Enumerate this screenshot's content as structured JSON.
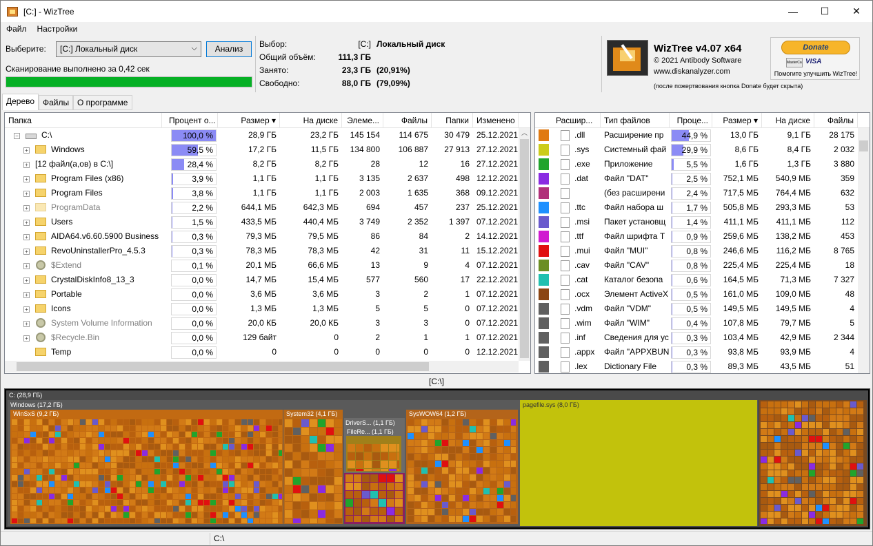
{
  "window": {
    "title": "[C:]  - WizTree",
    "minimize": "—",
    "maximize": "☐",
    "close": "✕"
  },
  "menu": [
    "Файл",
    "Настройки"
  ],
  "scan": {
    "select_label": "Выберите:",
    "drive_value": "[C:] Локальный диск",
    "analyze_button": "Анализ",
    "status_text": "Сканирование выполнено за 0,42 сек",
    "progress": 1.0
  },
  "info": {
    "selection_label": "Выбор:",
    "selection_drive": "[C:]",
    "selection_name": "Локальный диск",
    "total_label": "Общий объём:",
    "total_value": "111,3 ГБ",
    "used_label": "Занято:",
    "used_value": "23,3 ГБ",
    "used_pct": "(20,91%)",
    "free_label": "Свободно:",
    "free_value": "88,0 ГБ",
    "free_pct": "(79,09%)"
  },
  "brand": {
    "name": "WizTree v4.07 x64",
    "copyright": "© 2021 Antibody Software",
    "site": "www.diskanalyzer.com",
    "note": "(после пожертвования кнопка Donate будет скрыта)",
    "donate_label": "Donate",
    "donate_caption": "Помогите улучшить WizTree!",
    "card1": "MasterCard",
    "card2": "VISA"
  },
  "tabs": [
    "Дерево",
    "Файлы",
    "О программе"
  ],
  "tree": {
    "columns": [
      "Папка",
      "Процент о...",
      "Размер",
      "На диске",
      "Элеме...",
      "Файлы",
      "Папки",
      "Изменено"
    ],
    "rows": [
      {
        "name": "C:\\",
        "icon": "drive",
        "expand": "−",
        "indent": 0,
        "pct": 1.0,
        "pct_text": "100,0 %",
        "size": "28,9 ГБ",
        "disk": "23,2 ГБ",
        "items": "145 154",
        "files": "114 675",
        "folders": "30 479",
        "modified": "25.12.2021"
      },
      {
        "name": "Windows",
        "icon": "folder",
        "expand": "+",
        "indent": 1,
        "pct": 0.595,
        "pct_text": "59,5 %",
        "size": "17,2 ГБ",
        "disk": "11,5 ГБ",
        "items": "134 800",
        "files": "106 887",
        "folders": "27 913",
        "modified": "27.12.2021"
      },
      {
        "name": "[12 файл(а,ов) в C:\\]",
        "icon": "none",
        "expand": "+",
        "indent": 1,
        "pct": 0.284,
        "pct_text": "28,4 %",
        "size": "8,2 ГБ",
        "disk": "8,2 ГБ",
        "items": "28",
        "files": "12",
        "folders": "16",
        "modified": "27.12.2021"
      },
      {
        "name": "Program Files (x86)",
        "icon": "folder",
        "expand": "+",
        "indent": 1,
        "pct": 0.039,
        "pct_text": "3,9 %",
        "size": "1,1 ГБ",
        "disk": "1,1 ГБ",
        "items": "3 135",
        "files": "2 637",
        "folders": "498",
        "modified": "12.12.2021"
      },
      {
        "name": "Program Files",
        "icon": "folder",
        "expand": "+",
        "indent": 1,
        "pct": 0.038,
        "pct_text": "3,8 %",
        "size": "1,1 ГБ",
        "disk": "1,1 ГБ",
        "items": "2 003",
        "files": "1 635",
        "folders": "368",
        "modified": "09.12.2021"
      },
      {
        "name": "ProgramData",
        "icon": "folder-hidden",
        "expand": "+",
        "indent": 1,
        "pct": 0.022,
        "pct_text": "2,2 %",
        "size": "644,1 МБ",
        "disk": "642,3 МБ",
        "items": "694",
        "files": "457",
        "folders": "237",
        "modified": "25.12.2021"
      },
      {
        "name": "Users",
        "icon": "folder",
        "expand": "+",
        "indent": 1,
        "pct": 0.015,
        "pct_text": "1,5 %",
        "size": "433,5 МБ",
        "disk": "440,4 МБ",
        "items": "3 749",
        "files": "2 352",
        "folders": "1 397",
        "modified": "07.12.2021"
      },
      {
        "name": "AIDA64.v6.60.5900 Business",
        "icon": "folder",
        "expand": "+",
        "indent": 1,
        "pct": 0.003,
        "pct_text": "0,3 %",
        "size": "79,3 МБ",
        "disk": "79,5 МБ",
        "items": "86",
        "files": "84",
        "folders": "2",
        "modified": "14.12.2021"
      },
      {
        "name": "RevoUninstallerPro_4.5.3",
        "icon": "folder",
        "expand": "+",
        "indent": 1,
        "pct": 0.003,
        "pct_text": "0,3 %",
        "size": "78,3 МБ",
        "disk": "78,3 МБ",
        "items": "42",
        "files": "31",
        "folders": "11",
        "modified": "15.12.2021"
      },
      {
        "name": "$Extend",
        "icon": "gear",
        "expand": "+",
        "indent": 1,
        "pct": 0.001,
        "pct_text": "0,1 %",
        "size": "20,1 МБ",
        "disk": "66,6 МБ",
        "items": "13",
        "files": "9",
        "folders": "4",
        "modified": "07.12.2021"
      },
      {
        "name": "CrystalDiskInfo8_13_3",
        "icon": "folder",
        "expand": "+",
        "indent": 1,
        "pct": 0.0,
        "pct_text": "0,0 %",
        "size": "14,7 МБ",
        "disk": "15,4 МБ",
        "items": "577",
        "files": "560",
        "folders": "17",
        "modified": "22.12.2021"
      },
      {
        "name": "Portable",
        "icon": "folder",
        "expand": "+",
        "indent": 1,
        "pct": 0.0,
        "pct_text": "0,0 %",
        "size": "3,6 МБ",
        "disk": "3,6 МБ",
        "items": "3",
        "files": "2",
        "folders": "1",
        "modified": "07.12.2021"
      },
      {
        "name": "Icons",
        "icon": "folder",
        "expand": "+",
        "indent": 1,
        "pct": 0.0,
        "pct_text": "0,0 %",
        "size": "1,3 МБ",
        "disk": "1,3 МБ",
        "items": "5",
        "files": "5",
        "folders": "0",
        "modified": "07.12.2021"
      },
      {
        "name": "System Volume Information",
        "icon": "gear",
        "expand": "+",
        "indent": 1,
        "pct": 0.0,
        "pct_text": "0,0 %",
        "size": "20,0 КБ",
        "disk": "20,0 КБ",
        "items": "3",
        "files": "3",
        "folders": "0",
        "modified": "07.12.2021"
      },
      {
        "name": "$Recycle.Bin",
        "icon": "gear",
        "expand": "+",
        "indent": 1,
        "pct": 0.0,
        "pct_text": "0,0 %",
        "size": "129 байт",
        "disk": "0",
        "items": "2",
        "files": "1",
        "folders": "1",
        "modified": "07.12.2021"
      },
      {
        "name": "Temp",
        "icon": "folder",
        "expand": "",
        "indent": 1,
        "pct": 0.0,
        "pct_text": "0,0 %",
        "size": "0",
        "disk": "0",
        "items": "0",
        "files": "0",
        "folders": "0",
        "modified": "12.12.2021"
      }
    ]
  },
  "types": {
    "columns": [
      "Расшир...",
      "Тип файлов",
      "Проце...",
      "Размер",
      "На диске",
      "Файлы"
    ],
    "rows": [
      {
        "color": "#e07a12",
        "ext": ".dll",
        "type": "Расширение пр",
        "pct": 0.449,
        "pct_text": "44,9 %",
        "size": "13,0 ГБ",
        "disk": "9,1 ГБ",
        "files": "28 175"
      },
      {
        "color": "#cccc1a",
        "ext": ".sys",
        "type": "Системный фай",
        "pct": 0.299,
        "pct_text": "29,9 %",
        "size": "8,6 ГБ",
        "disk": "8,4 ГБ",
        "files": "2 032"
      },
      {
        "color": "#21a42c",
        "ext": ".exe",
        "type": "Приложение",
        "pct": 0.055,
        "pct_text": "5,5 %",
        "size": "1,6 ГБ",
        "disk": "1,3 ГБ",
        "files": "3 880"
      },
      {
        "color": "#8a2be2",
        "ext": ".dat",
        "type": "Файл \"DAT\"",
        "pct": 0.025,
        "pct_text": "2,5 %",
        "size": "752,1 МБ",
        "disk": "540,9 МБ",
        "files": "359"
      },
      {
        "color": "#b0307a",
        "ext": "",
        "type": "(без расширени",
        "pct": 0.024,
        "pct_text": "2,4 %",
        "size": "717,5 МБ",
        "disk": "764,4 МБ",
        "files": "632"
      },
      {
        "color": "#1e90ff",
        "ext": ".ttc",
        "type": "Файл набора ш",
        "pct": 0.017,
        "pct_text": "1,7 %",
        "size": "505,8 МБ",
        "disk": "293,3 МБ",
        "files": "53"
      },
      {
        "color": "#6a5acd",
        "ext": ".msi",
        "type": "Пакет установщ",
        "pct": 0.014,
        "pct_text": "1,4 %",
        "size": "411,1 МБ",
        "disk": "411,1 МБ",
        "files": "112"
      },
      {
        "color": "#d01bd0",
        "ext": ".ttf",
        "type": "Файл шрифта T",
        "pct": 0.009,
        "pct_text": "0,9 %",
        "size": "259,6 МБ",
        "disk": "138,2 МБ",
        "files": "453"
      },
      {
        "color": "#e01010",
        "ext": ".mui",
        "type": "Файл \"MUI\"",
        "pct": 0.008,
        "pct_text": "0,8 %",
        "size": "246,6 МБ",
        "disk": "116,2 МБ",
        "files": "8 765"
      },
      {
        "color": "#6b8e23",
        "ext": ".cav",
        "type": "Файл \"CAV\"",
        "pct": 0.008,
        "pct_text": "0,8 %",
        "size": "225,4 МБ",
        "disk": "225,4 МБ",
        "files": "18"
      },
      {
        "color": "#20c0b0",
        "ext": ".cat",
        "type": "Каталог безопа",
        "pct": 0.006,
        "pct_text": "0,6 %",
        "size": "164,5 МБ",
        "disk": "71,3 МБ",
        "files": "7 327"
      },
      {
        "color": "#8b4513",
        "ext": ".ocx",
        "type": "Элемент ActiveX",
        "pct": 0.005,
        "pct_text": "0,5 %",
        "size": "161,0 МБ",
        "disk": "109,0 МБ",
        "files": "48"
      },
      {
        "color": "#606060",
        "ext": ".vdm",
        "type": "Файл \"VDM\"",
        "pct": 0.005,
        "pct_text": "0,5 %",
        "size": "149,5 МБ",
        "disk": "149,5 МБ",
        "files": "4"
      },
      {
        "color": "#606060",
        "ext": ".wim",
        "type": "Файл \"WIM\"",
        "pct": 0.004,
        "pct_text": "0,4 %",
        "size": "107,8 МБ",
        "disk": "79,7 МБ",
        "files": "5"
      },
      {
        "color": "#606060",
        "ext": ".inf",
        "type": "Сведения для ус",
        "pct": 0.003,
        "pct_text": "0,3 %",
        "size": "103,4 МБ",
        "disk": "42,9 МБ",
        "files": "2 344"
      },
      {
        "color": "#606060",
        "ext": ".appx",
        "type": "Файл \"APPXBUN",
        "pct": 0.003,
        "pct_text": "0,3 %",
        "size": "93,8 МБ",
        "disk": "93,9 МБ",
        "files": "4"
      },
      {
        "color": "#606060",
        "ext": ".lex",
        "type": "Dictionary File",
        "pct": 0.003,
        "pct_text": "0,3 %",
        "size": "89,3 МБ",
        "disk": "43,5 МБ",
        "files": "51"
      }
    ]
  },
  "path_label": "[C:\\]",
  "treemap": {
    "labels": [
      "C: (28,9 ГБ)",
      "Windows (17,2 ГБ)",
      "WinSxS (9,2 ГБ)",
      "System32 (4,1 ГБ)",
      "DriverS... (1,1 ГБ)",
      "FileRe... (1,1 ГБ)",
      "SysWOW64 (1,2 ГБ)",
      "pagefile.sys (8,0 ГБ)"
    ]
  },
  "status_path": "C:\\"
}
